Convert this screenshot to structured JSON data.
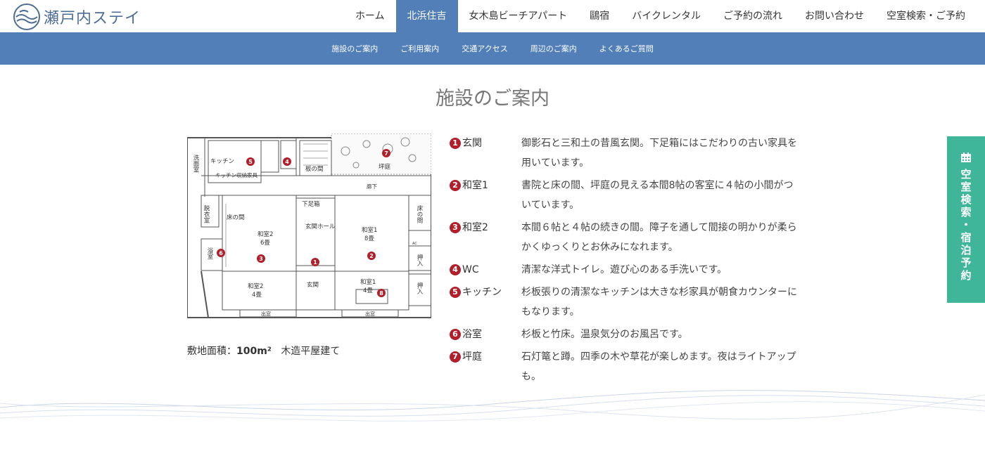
{
  "header": {
    "logo_text": "瀬戸内ステイ",
    "nav": [
      "ホーム",
      "北浜住吉",
      "女木島ビーチアパート",
      "鷗宿",
      "バイクレンタル",
      "ご予約の流れ",
      "お問い合わせ",
      "空室検索・ご予約"
    ],
    "active_nav": "北浜住吉"
  },
  "subnav": [
    "施設のご案内",
    "ご利用案内",
    "交通アクセス",
    "周辺のご案内",
    "よくあるご質問"
  ],
  "page_title": "施設のご案内",
  "floorplan": {
    "labels": {
      "wash": "洗面室",
      "kitchen": "キッチン",
      "kitchen_storage": "キッチン収納家具",
      "itanoma": "板の間",
      "tsuboniwa": "坪庭",
      "rouka": "廊下",
      "datsui": "脱衣室",
      "tokonoma_l": "床の間",
      "geta": "下足箱",
      "tokonoma_r": "床の間",
      "washitsu2": "和室2",
      "tatami6": "6畳",
      "genkan_hall": "玄関ホール",
      "washitsu1": "和室1",
      "tatami8": "8畳",
      "yokushitsu": "浴室",
      "oshiire1": "押入",
      "oshiire2": "押入",
      "washitsu2b": "和室2",
      "tatami4b": "4畳",
      "genkan": "玄関",
      "washitsu1b": "和室1",
      "tatami4c": "4畳",
      "demado1": "出窓",
      "demado2": "出窓",
      "ac": "AC"
    }
  },
  "area_note": {
    "label": "敷地面積：",
    "value": "100m²",
    "rest": "木造平屋建て"
  },
  "facilities": [
    {
      "num": "1",
      "name": "玄関",
      "desc": "御影石と三和土の昔風玄関。下足箱にはこだわりの古い家具を用いています。"
    },
    {
      "num": "2",
      "name": "和室1",
      "desc": "書院と床の間、坪庭の見える本間8帖の客室に４帖の小間がついています。"
    },
    {
      "num": "3",
      "name": "和室2",
      "desc": "本間６帖と４帖の続きの間。障子を通して間接の明かりが柔らかくゆっくりとお休みになれます。"
    },
    {
      "num": "4",
      "name": "WC",
      "desc": "清潔な洋式トイレ。遊び心のある手洗いです。"
    },
    {
      "num": "5",
      "name": "キッチン",
      "desc": "杉板張りの清潔なキッチンは大きな杉家具が朝食カウンターにもなります。"
    },
    {
      "num": "6",
      "name": "浴室",
      "desc": "杉板と竹床。温泉気分のお風呂です。"
    },
    {
      "num": "7",
      "name": "坪庭",
      "desc": "石灯篭と蹲。四季の木や草花が楽しめます。夜はライトアップも。"
    }
  ],
  "side_tab": {
    "text": "空室検索・宿泊予約"
  },
  "colors": {
    "nav_blue": "#527fb8",
    "accent_red": "#b21f2a",
    "side_green": "#3fb59a"
  },
  "icons": {
    "logo": "wave-logo-icon",
    "side_tab": "calendar-icon"
  }
}
